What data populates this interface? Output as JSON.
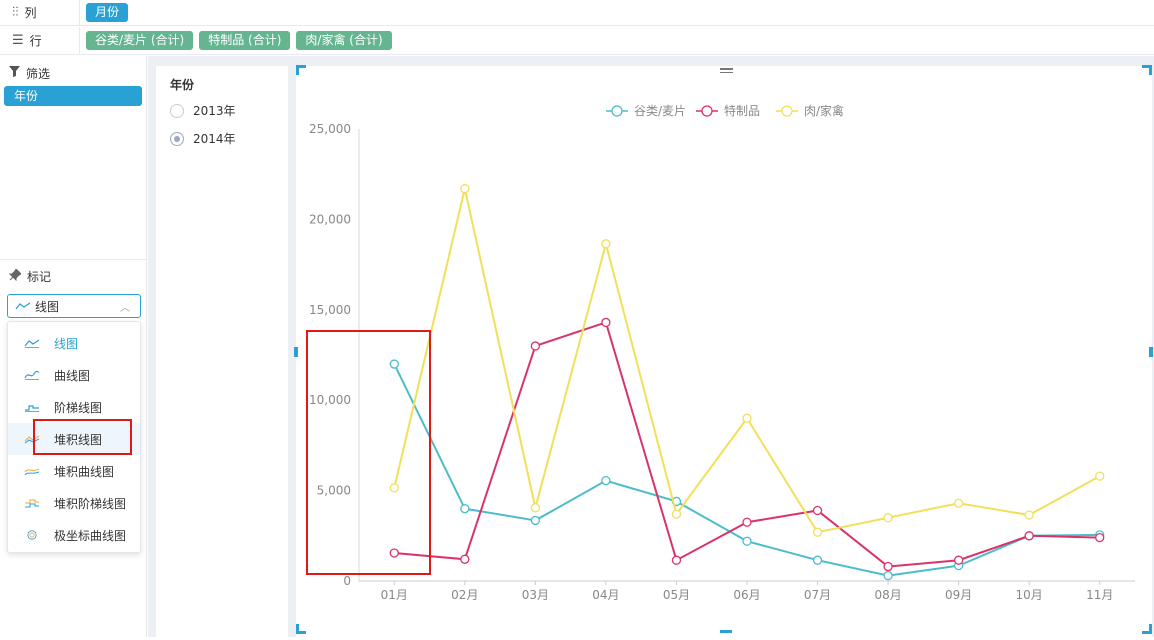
{
  "shelf": {
    "columns_label": "列",
    "columns_pills": [
      "月份"
    ],
    "rows_label": "行",
    "rows_pills": [
      "谷类/麦片 (合计)",
      "特制品 (合计)",
      "肉/家禽 (合计)"
    ]
  },
  "left": {
    "filter_title": "筛选",
    "filter_item": "年份",
    "mark_title": "标记",
    "mark_select_value": "线图",
    "mark_options": [
      "线图",
      "曲线图",
      "阶梯线图",
      "堆积线图",
      "堆积曲线图",
      "堆积阶梯线图",
      "极坐标曲线图"
    ]
  },
  "year_filter": {
    "title": "年份",
    "options": [
      "2013年",
      "2014年"
    ],
    "selected": "2014年"
  },
  "colors": {
    "accent": "#2aa1d4",
    "green_pill": "#64b590",
    "series1": "#4bbccc",
    "series2": "#d9336b",
    "series3": "#f2df5a"
  },
  "chart_data": {
    "type": "line",
    "categories": [
      "01月",
      "02月",
      "03月",
      "04月",
      "05月",
      "06月",
      "07月",
      "08月",
      "09月",
      "10月",
      "11月"
    ],
    "series": [
      {
        "name": "谷类/麦片",
        "color": "#4bbccc",
        "values": [
          12000,
          4000,
          3350,
          5550,
          4400,
          2200,
          1150,
          300,
          850,
          2500,
          2550
        ]
      },
      {
        "name": "特制品",
        "color": "#d9336b",
        "values": [
          1550,
          1200,
          13000,
          14300,
          1150,
          3250,
          3900,
          800,
          1150,
          2500,
          2400
        ]
      },
      {
        "name": "肉/家禽",
        "color": "#f2df5a",
        "values": [
          5150,
          21700,
          4050,
          18650,
          3700,
          9000,
          2700,
          3500,
          4300,
          3650,
          5800
        ]
      }
    ],
    "ylim": [
      0,
      25000
    ],
    "yticks": [
      0,
      5000,
      10000,
      15000,
      20000,
      25000
    ],
    "ytick_labels": [
      "0",
      "5,000",
      "10,000",
      "15,000",
      "20,000",
      "25,000"
    ],
    "legend_position": "top-center"
  }
}
